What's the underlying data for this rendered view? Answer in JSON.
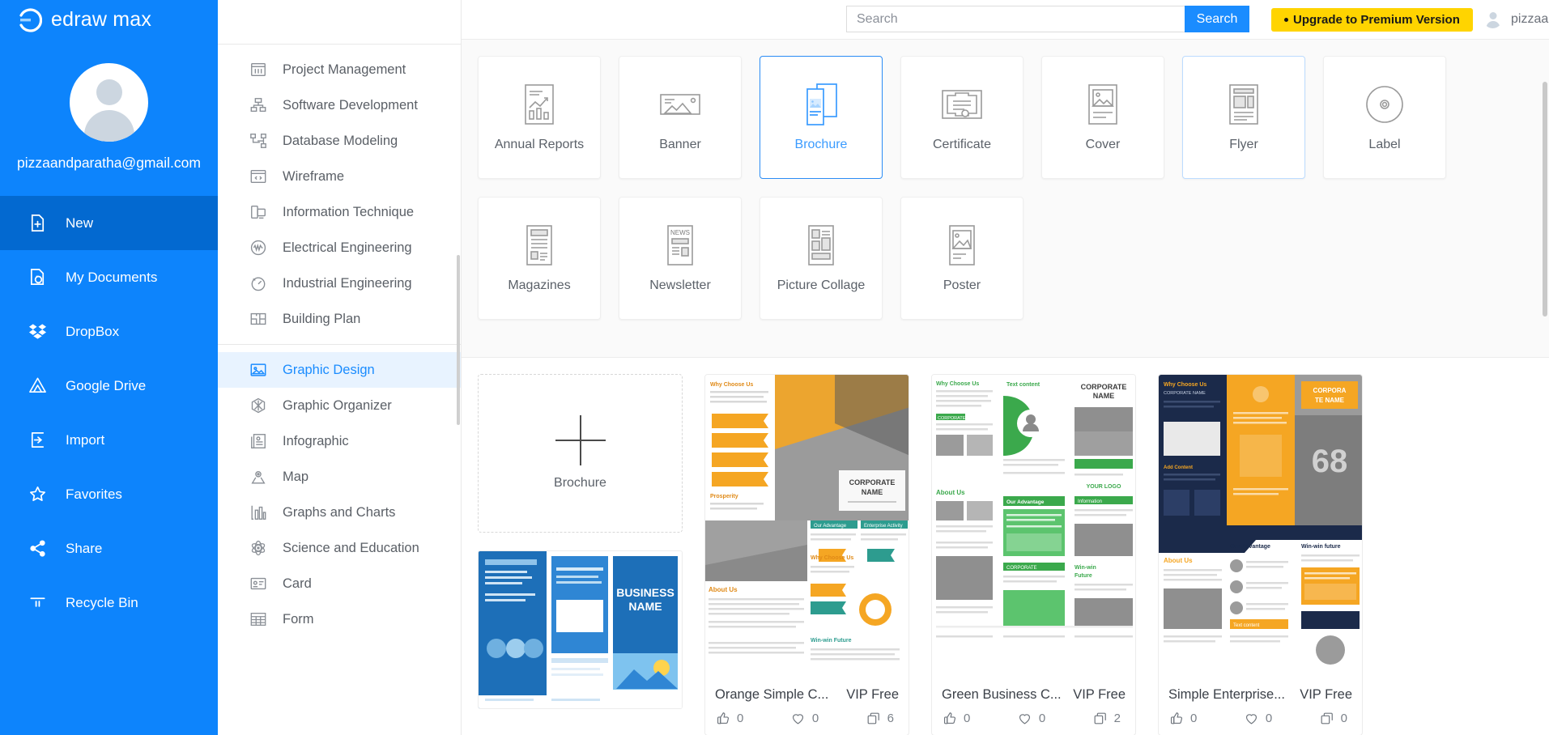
{
  "app": {
    "brand": "edraw max"
  },
  "sidebar": {
    "profile": {
      "email": "pizzaandparatha@gmail.com",
      "avatar_icon": "user-avatar-icon"
    },
    "items": [
      {
        "label": "New",
        "icon": "new-document-icon",
        "active": true
      },
      {
        "label": "My Documents",
        "icon": "cloud-document-icon",
        "active": false
      },
      {
        "label": "DropBox",
        "icon": "dropbox-icon",
        "active": false
      },
      {
        "label": "Google Drive",
        "icon": "google-drive-icon",
        "active": false
      },
      {
        "label": "Import",
        "icon": "import-arrow-icon",
        "active": false
      },
      {
        "label": "Favorites",
        "icon": "star-icon",
        "active": false
      },
      {
        "label": "Share",
        "icon": "share-nodes-icon",
        "active": false
      },
      {
        "label": "Recycle Bin",
        "icon": "trash-icon",
        "active": false
      }
    ]
  },
  "categories": {
    "group_one": [
      {
        "label": "Project Management",
        "icon": "gantt-chart-icon"
      },
      {
        "label": "Software Development",
        "icon": "org-tree-icon"
      },
      {
        "label": "Database Modeling",
        "icon": "database-nodes-icon"
      },
      {
        "label": "Wireframe",
        "icon": "browser-code-icon"
      },
      {
        "label": "Information Technique",
        "icon": "devices-icon"
      },
      {
        "label": "Electrical Engineering",
        "icon": "waveform-circle-icon"
      },
      {
        "label": "Industrial Engineering",
        "icon": "gauge-icon"
      },
      {
        "label": "Building Plan",
        "icon": "floorplan-icon"
      }
    ],
    "group_two": [
      {
        "label": "Graphic Design",
        "icon": "image-frame-icon",
        "active": true
      },
      {
        "label": "Graphic Organizer",
        "icon": "hexagon-star-icon",
        "active": false
      },
      {
        "label": "Infographic",
        "icon": "infographic-icon",
        "active": false
      },
      {
        "label": "Map",
        "icon": "map-pin-icon",
        "active": false
      },
      {
        "label": "Graphs and Charts",
        "icon": "bar-chart-icon",
        "active": false
      },
      {
        "label": "Science and Education",
        "icon": "atom-icon",
        "active": false
      },
      {
        "label": "Card",
        "icon": "id-card-icon",
        "active": false
      },
      {
        "label": "Form",
        "icon": "table-grid-icon",
        "active": false
      }
    ]
  },
  "header": {
    "search": {
      "placeholder": "Search",
      "value": "",
      "button_label": "Search",
      "icon": "search-icon"
    },
    "upgrade_label": "Upgrade to Premium Version",
    "user_name": "pizzaan...",
    "user_avatar_icon": "user-avatar-icon"
  },
  "template_types": {
    "row1": [
      {
        "label": "Annual Reports",
        "icon": "annual-report-icon",
        "state": "normal"
      },
      {
        "label": "Banner",
        "icon": "banner-icon",
        "state": "normal"
      },
      {
        "label": "Brochure",
        "icon": "brochure-icon",
        "state": "selected"
      },
      {
        "label": "Certificate",
        "icon": "certificate-icon",
        "state": "normal"
      },
      {
        "label": "Cover",
        "icon": "cover-icon",
        "state": "normal"
      },
      {
        "label": "Flyer",
        "icon": "flyer-icon",
        "state": "hovered"
      },
      {
        "label": "Label",
        "icon": "disc-label-icon",
        "state": "normal"
      }
    ],
    "row2": [
      {
        "label": "Magazines",
        "icon": "magazine-icon",
        "state": "normal"
      },
      {
        "label": "Newsletter",
        "icon": "newsletter-icon",
        "state": "normal"
      },
      {
        "label": "Picture Collage",
        "icon": "collage-icon",
        "state": "normal"
      },
      {
        "label": "Poster",
        "icon": "poster-icon",
        "state": "normal"
      }
    ]
  },
  "gallery": {
    "new_document": {
      "label": "Brochure",
      "icon": "plus-icon"
    },
    "templates": [
      {
        "title": "Orange Simple C...",
        "vip": "VIP Free",
        "likes": "0",
        "favorites": "0",
        "copies": "6"
      },
      {
        "title": "Green Business C...",
        "vip": "VIP Free",
        "likes": "0",
        "favorites": "0",
        "copies": "2"
      },
      {
        "title": "Simple Enterprise...",
        "vip": "VIP Free",
        "likes": "0",
        "favorites": "0",
        "copies": "0"
      }
    ],
    "stat_icons": {
      "like": "thumbs-up-icon",
      "favorite": "heart-icon",
      "copy": "copies-icon"
    }
  },
  "colors": {
    "brand_blue": "#0d84fc",
    "accent_blue": "#1a8cff",
    "upgrade_yellow": "#ffd400",
    "active_nav": "#0369d0"
  }
}
